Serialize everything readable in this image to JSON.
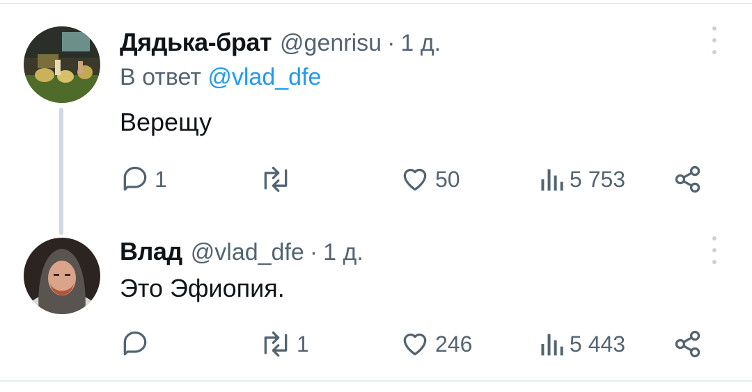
{
  "tweets": [
    {
      "name": "Дядька-брат",
      "handle": "@genrisu",
      "time": "1 д.",
      "reply_prefix": "В ответ",
      "reply_mention": "@vlad_dfe",
      "text": "Верещу",
      "replies": "1",
      "retweets": "",
      "likes": "50",
      "views": "5 753"
    },
    {
      "name": "Влад",
      "handle": "@vlad_dfe",
      "time": "1 д.",
      "text": "Это Эфиопия.",
      "replies": "",
      "retweets": "1",
      "likes": "246",
      "views": "5 443"
    }
  ],
  "icons": {
    "reply": "reply-icon",
    "retweet": "retweet-icon",
    "like": "heart-icon",
    "views": "views-chart-icon",
    "share": "share-icon",
    "more": "more-vertical-icon"
  },
  "colors": {
    "text": "#0f1419",
    "secondary": "#536471",
    "link": "#1d9bf0",
    "thread_line": "#cfd9de",
    "divider": "#e6ebef"
  }
}
